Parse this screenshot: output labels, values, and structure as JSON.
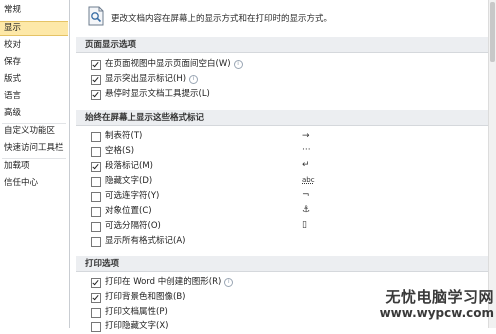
{
  "nav": {
    "items": [
      {
        "label": "常规",
        "selected": false
      },
      {
        "label": "显示",
        "selected": true
      },
      {
        "label": "校对",
        "selected": false
      },
      {
        "label": "保存",
        "selected": false
      },
      {
        "label": "版式",
        "selected": false
      },
      {
        "label": "语言",
        "selected": false
      },
      {
        "label": "高级",
        "selected": false
      },
      {
        "label": "自定义功能区",
        "selected": false
      },
      {
        "label": "快速访问工具栏",
        "selected": false
      },
      {
        "label": "加载项",
        "selected": false
      },
      {
        "label": "信任中心",
        "selected": false
      }
    ]
  },
  "header": {
    "icon": "document-display-icon",
    "text": "更改文档内容在屏幕上的显示方式和在打印时的显示方式。"
  },
  "sections": [
    {
      "title": "页面显示选项",
      "options": [
        {
          "label": "在页面视图中显示页面间空白(W)",
          "checked": true,
          "info": true
        },
        {
          "label": "显示突出显示标记(H)",
          "checked": true,
          "info": true
        },
        {
          "label": "悬停时显示文档工具提示(L)",
          "checked": true,
          "info": false
        }
      ]
    },
    {
      "title": "始终在屏幕上显示这些格式标记",
      "options": [
        {
          "label": "制表符(T)",
          "checked": false,
          "mark": "→"
        },
        {
          "label": "空格(S)",
          "checked": false,
          "mark": "···"
        },
        {
          "label": "段落标记(M)",
          "checked": true,
          "mark": "↵"
        },
        {
          "label": "隐藏文字(D)",
          "checked": false,
          "mark": "abc"
        },
        {
          "label": "可选连字符(Y)",
          "checked": false,
          "mark": "¬"
        },
        {
          "label": "对象位置(C)",
          "checked": false,
          "mark": "⚓"
        },
        {
          "label": "可选分隔符(O)",
          "checked": false,
          "mark": "▯"
        },
        {
          "label": "显示所有格式标记(A)",
          "checked": false,
          "mark": ""
        }
      ]
    },
    {
      "title": "打印选项",
      "options": [
        {
          "label": "打印在 Word 中创建的图形(R)",
          "checked": true,
          "info": true
        },
        {
          "label": "打印背景色和图像(B)",
          "checked": true,
          "info": false
        },
        {
          "label": "打印文档属性(P)",
          "checked": false,
          "info": false
        },
        {
          "label": "打印隐藏文字(X)",
          "checked": false,
          "info": false
        }
      ]
    }
  ],
  "watermark": {
    "line1": "无忧电脑学习网",
    "line2": "www.wypcw.com"
  }
}
